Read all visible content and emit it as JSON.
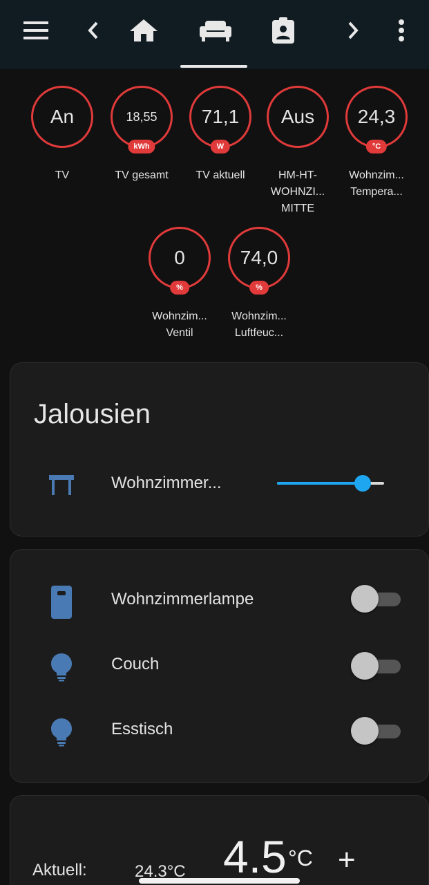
{
  "toolbar": {
    "icons": [
      "menu-icon",
      "chevron-left-icon",
      "home-icon",
      "sofa-icon",
      "clipboard-account-icon",
      "chevron-right-icon",
      "more-vertical-icon"
    ],
    "active_tab": "sofa-icon"
  },
  "badges": [
    {
      "value": "An",
      "unit": "",
      "label": "TV"
    },
    {
      "value": "18,55",
      "unit": "kWh",
      "label": "TV gesamt"
    },
    {
      "value": "71,1",
      "unit": "W",
      "label": "TV aktuell"
    },
    {
      "value": "Aus",
      "unit": "",
      "label": "HM-HT-\nWOHNZI...\nMITTE"
    },
    {
      "value": "24,3",
      "unit": "°C",
      "label": "Wohnzim...\nTempera..."
    },
    {
      "value": "0",
      "unit": "%",
      "label": "Wohnzim...\nVentil"
    },
    {
      "value": "74,0",
      "unit": "%",
      "label": "Wohnzim...\nLuftfeuc..."
    }
  ],
  "jalousien": {
    "title": "Jalousien",
    "row_label": "Wohnzimmer...",
    "position_percent": 80
  },
  "lights": [
    {
      "label": "Wohnzimmerlampe",
      "icon": "light-switch-icon",
      "on": false
    },
    {
      "label": "Couch",
      "icon": "lightbulb-icon",
      "on": false
    },
    {
      "label": "Esstisch",
      "icon": "lightbulb-icon",
      "on": false
    }
  ],
  "thermostat": {
    "current_label": "Aktuell:",
    "current_value": "24.3°C",
    "target_value": "4.5",
    "target_unit": "°C",
    "plus": "+"
  },
  "colors": {
    "accent_red": "#e03a3a",
    "accent_blue": "#1ea7f0",
    "icon_blue": "#4a7ab4",
    "background": "#111111",
    "card": "#1c1c1c"
  }
}
